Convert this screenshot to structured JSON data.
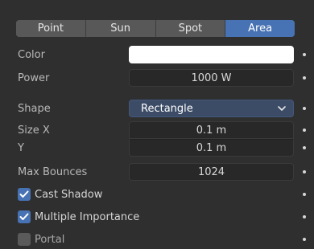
{
  "tabs": [
    {
      "label": "Point",
      "active": false
    },
    {
      "label": "Sun",
      "active": false
    },
    {
      "label": "Spot",
      "active": false
    },
    {
      "label": "Area",
      "active": true
    }
  ],
  "color": {
    "label": "Color",
    "value": "#ffffff"
  },
  "power": {
    "label": "Power",
    "value": "1000 W"
  },
  "shape": {
    "label": "Shape",
    "value": "Rectangle"
  },
  "size_x": {
    "label": "Size X",
    "value": "0.1 m"
  },
  "size_y": {
    "label": "Y",
    "value": "0.1 m"
  },
  "max_bounces": {
    "label": "Max Bounces",
    "value": "1024"
  },
  "cast_shadow": {
    "label": "Cast Shadow",
    "checked": true
  },
  "multiple_importance": {
    "label": "Multiple Importance",
    "checked": true
  },
  "portal": {
    "label": "Portal",
    "checked": false
  },
  "colors": {
    "accent": "#4772b3",
    "background": "#2f2f2f",
    "field": "#282828"
  }
}
